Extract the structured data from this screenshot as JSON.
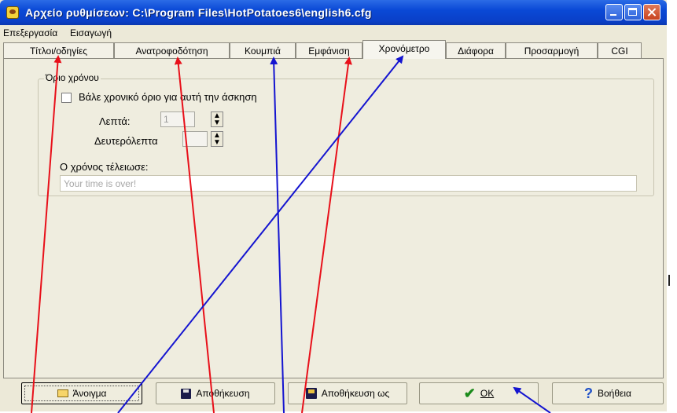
{
  "window": {
    "title": "Αρχείο ρυθμίσεων:  C:\\Program Files\\HotPotatoes6\\english6.cfg"
  },
  "menu": [
    "Επεξεργασία",
    "Εισαγωγή"
  ],
  "tabs": [
    {
      "label": "Τίτλοι/οδηγίες",
      "active": false
    },
    {
      "label": "Ανατροφοδότηση",
      "active": false
    },
    {
      "label": "Κουμπιά",
      "active": false
    },
    {
      "label": "Εμφάνιση",
      "active": false
    },
    {
      "label": "Χρονόμετρο",
      "active": true
    },
    {
      "label": "Διάφορα",
      "active": false
    },
    {
      "label": "Προσαρμογή",
      "active": false
    },
    {
      "label": "CGI",
      "active": false
    }
  ],
  "timer": {
    "group_title": "Όριο χρόνου",
    "checkbox_label": "Βάλε χρονικό όριο για αυτή την άσκηση",
    "checkbox_checked": false,
    "minutes_label": "Λεπτά:",
    "minutes_value": "1",
    "seconds_label": "Δευτερόλεπτα",
    "seconds_value": "",
    "time_up_label": "Ο χρόνος τέλειωσε:",
    "time_up_value": "Your time is over!"
  },
  "buttons": {
    "open": "Άνοιγμα",
    "save": "Αποθήκευση",
    "save_as": "Αποθήκευση ως",
    "ok": "OK",
    "help": "Βοήθεια"
  },
  "icons": {
    "app": "hot-potatoes-icon",
    "open": "folder-open-icon",
    "save": "floppy-disk-icon",
    "save_as": "floppy-save-as-icon",
    "ok": "checkmark-icon",
    "help": "question-mark-icon"
  },
  "colors": {
    "titlebar": "#0a49d6",
    "red_arrows": "#e8101a",
    "blue_arrows": "#1414d0"
  }
}
